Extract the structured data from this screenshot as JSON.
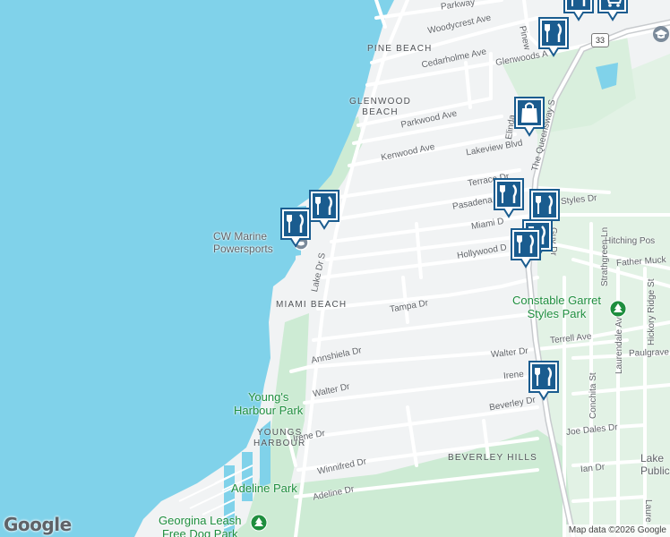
{
  "map": {
    "colors": {
      "water": "#80d2ea",
      "land": "#f1f3f4",
      "park": "#cdebd4",
      "road": "#ffffff",
      "highway": "#c8cbce",
      "marker": "#1a5c8f"
    },
    "neighborhoods": {
      "pine_beach": "PINE BEACH",
      "glenwood_line1": "GLENWOOD",
      "glenwood_line2": "BEACH",
      "miami_beach": "MIAMI BEACH",
      "youngs_line1": "YOUNGS",
      "youngs_line2": "HARBOUR",
      "beverley_hills": "BEVERLEY HILLS"
    },
    "streets": {
      "parkway": "Parkway",
      "woodycrest": "Woodycrest Ave",
      "cedarholme": "Cedarholme Ave",
      "glenwoods": "Glenwoods A",
      "parkwood": "Parkwood Ave",
      "kenwood": "Kenwood Ave",
      "lakeview": "Lakeview Blvd",
      "elinda": "Elinda",
      "terrace": "Terrace Dr",
      "pasadena": "Pasadena",
      "miami": "Miami D",
      "styles": "Styles Dr",
      "guy": "Guy Dr",
      "hitching": "Hitching Pos",
      "father": "Father Muck",
      "hollywood": "Hollywood D",
      "lake_dr": "Lake Dr S",
      "tampa": "Tampa Dr",
      "annshiela": "Annshiela Dr",
      "walter_e": "Walter Dr",
      "terrell": "Terrell Ave",
      "paulgrave": "Paulgrave",
      "irene_e": "Irene",
      "walter_w": "Walter Dr",
      "beverley": "Beverley Dr",
      "irene_w": "Irene Dr",
      "joe_dales": "Joe Dales Dr",
      "winnifred": "Winnifred Dr",
      "ian": "Ian Dr",
      "adeline": "Adeline Dr",
      "queensway": "The Queensway S",
      "pinew": "Pinew",
      "strathgreen": "Strathgreen Ln",
      "laurendale": "Laurendale Ave",
      "hickory": "Hickory Ridge St",
      "conchita": "Conchita St",
      "laure": "Laure"
    },
    "parks": {
      "constable_line1": "Constable Garret",
      "constable_line2": "Styles Park",
      "youngs_line1": "Young's",
      "youngs_line2": "Harbour Park",
      "adeline": "Adeline Park",
      "georgina_line1": "Georgina Leash",
      "georgina_line2": "Free Dog Park"
    },
    "pois": {
      "marine_line1": "CW Marine",
      "marine_line2": "Powersports",
      "lake_line1": "Lake",
      "lake_line2": "Public"
    },
    "highway_shield": "33",
    "markers": [
      {
        "type": "restaurant",
        "icon": "fork-knife-icon"
      },
      {
        "type": "restaurant",
        "icon": "fork-knife-icon"
      },
      {
        "type": "restaurant",
        "icon": "fork-knife-icon"
      },
      {
        "type": "restaurant",
        "icon": "fork-knife-icon"
      },
      {
        "type": "restaurant",
        "icon": "fork-knife-icon"
      },
      {
        "type": "restaurant",
        "icon": "fork-knife-icon"
      },
      {
        "type": "restaurant",
        "icon": "fork-knife-icon"
      },
      {
        "type": "restaurant",
        "icon": "fork-knife-icon"
      },
      {
        "type": "restaurant",
        "icon": "fork-knife-icon"
      },
      {
        "type": "shopping",
        "icon": "shopping-bag-icon"
      },
      {
        "type": "shopping",
        "icon": "shopping-cart-icon"
      }
    ],
    "logo": "Google",
    "attribution": "Map data ©2026 Google"
  }
}
